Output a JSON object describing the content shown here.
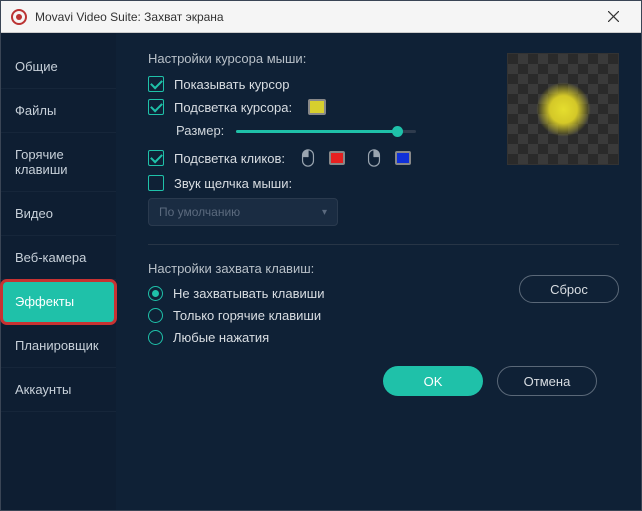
{
  "title": "Movavi Video Suite: Захват экрана",
  "sidebar": {
    "items": [
      {
        "label": "Общие"
      },
      {
        "label": "Файлы"
      },
      {
        "label": "Горячие клавиши"
      },
      {
        "label": "Видео"
      },
      {
        "label": "Веб-камера"
      },
      {
        "label": "Эффекты"
      },
      {
        "label": "Планировщик"
      },
      {
        "label": "Аккаунты"
      }
    ],
    "active_index": 5
  },
  "cursor": {
    "section_title": "Настройки курсора мыши:",
    "show_label": "Показывать курсор",
    "highlight_label": "Подсветка курсора:",
    "highlight_color": "#d7cf2e",
    "size_label": "Размер:",
    "click_highlight_label": "Подсветка кликов:",
    "left_click_color": "#e62020",
    "right_click_color": "#1030d8",
    "click_sound_label": "Звук щелчка мыши:",
    "sound_dropdown": "По умолчанию",
    "reset_label": "Сброс"
  },
  "keys": {
    "section_title": "Настройки захвата клавиш:",
    "options": [
      {
        "label": "Не захватывать клавиши"
      },
      {
        "label": "Только горячие клавиши"
      },
      {
        "label": "Любые нажатия"
      }
    ],
    "selected_index": 0
  },
  "footer": {
    "ok": "OK",
    "cancel": "Отмена"
  }
}
